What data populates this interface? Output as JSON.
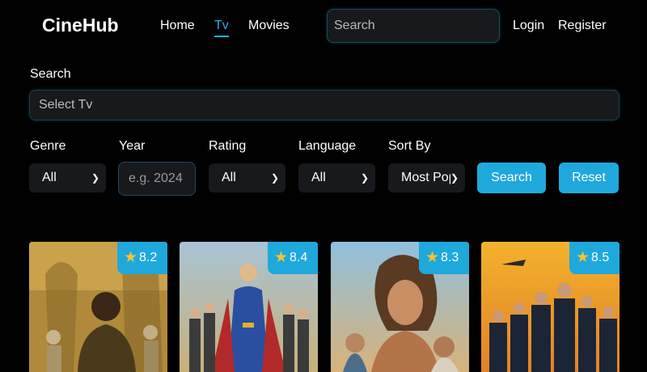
{
  "navbar": {
    "logo": "CineHub",
    "links": [
      {
        "label": "Home",
        "active": false
      },
      {
        "label": "Tv",
        "active": true
      },
      {
        "label": "Movies",
        "active": false
      }
    ],
    "search_placeholder": "Search",
    "login_label": "Login",
    "register_label": "Register"
  },
  "filters": {
    "search_label": "Search",
    "select_placeholder": "Select Tv",
    "genre": {
      "label": "Genre",
      "value": "All"
    },
    "year": {
      "label": "Year",
      "placeholder": "e.g. 2024"
    },
    "rating": {
      "label": "Rating",
      "value": "All"
    },
    "language": {
      "label": "Language",
      "value": "All"
    },
    "sort_by": {
      "label": "Sort By",
      "value": "Most Pop"
    },
    "search_button": "Search",
    "reset_button": "Reset"
  },
  "cards": [
    {
      "rating": "8.2",
      "star_icon": "star-icon"
    },
    {
      "rating": "8.4",
      "star_icon": "star-icon"
    },
    {
      "rating": "8.3",
      "star_icon": "star-icon"
    },
    {
      "rating": "8.5",
      "star_icon": "star-icon"
    }
  ],
  "colors": {
    "accent": "#1fa8dc",
    "background": "#000000",
    "field": "#17191c",
    "star": "#f7c331"
  }
}
